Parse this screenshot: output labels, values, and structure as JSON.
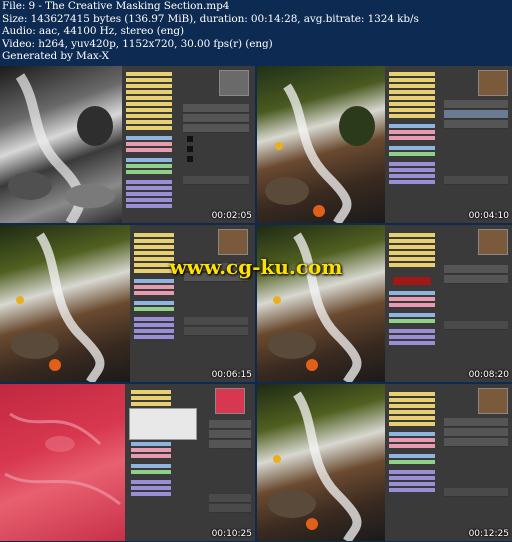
{
  "header": {
    "file": "File: 9 - The Creative Masking Section.mp4",
    "size": "Size: 143627415 bytes (136.97 MiB), duration: 00:14:28, avg.bitrate: 1324 kb/s",
    "audio": "Audio: aac, 44100 Hz, stereo (eng)",
    "video": "Video: h264, yuv420p, 1152x720, 30.00 fps(r) (eng)",
    "generator": "Generated by Max-X"
  },
  "watermark": "www.cg-ku.com",
  "thumbnails": [
    {
      "timestamp": "00:02:05",
      "photo": "grayscale"
    },
    {
      "timestamp": "00:04:10",
      "photo": "color"
    },
    {
      "timestamp": "00:06:15",
      "photo": "color"
    },
    {
      "timestamp": "00:08:20",
      "photo": "color"
    },
    {
      "timestamp": "00:10:25",
      "photo": "red-mask"
    },
    {
      "timestamp": "00:12:25",
      "photo": "color"
    }
  ],
  "colors": {
    "background": "#0d2a52",
    "timestamp_text": "#ffffff",
    "watermark": "#ffe000",
    "panel_yellow": "#e8d070",
    "panel_blue": "#8fb4e0",
    "panel_pink": "#e89ab0",
    "panel_green": "#8fd08a",
    "panel_purple": "#9a8fd6",
    "mask_red": "#d8384f"
  }
}
